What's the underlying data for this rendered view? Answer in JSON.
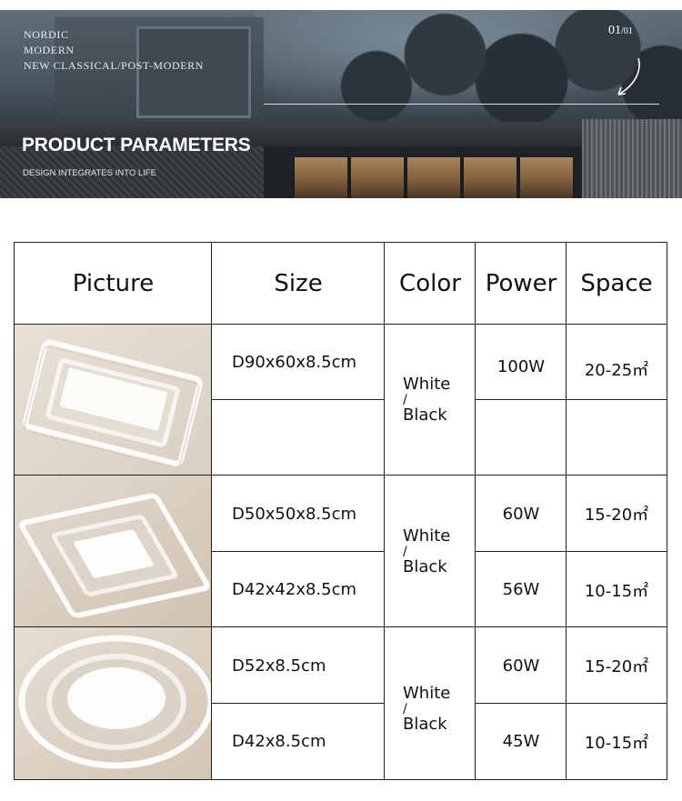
{
  "banner": {
    "tag_lines": [
      "NORDIC",
      "MODERN",
      "NEW CLASSICAL/POST-MODERN"
    ],
    "page_current": "01",
    "page_total": "/01",
    "title": "PRODUCT PARAMETERS",
    "subtitle": "DESIGN INTEGRATES INTO LIFE"
  },
  "table": {
    "headers": [
      "Picture",
      "Size",
      "Color",
      "Power",
      "Space"
    ],
    "groups": [
      {
        "picture": "rectangular-lamp-image",
        "color": [
          "White",
          "/",
          "Black"
        ],
        "rows": [
          {
            "size": "D90x60x8.5cm",
            "power": "100W",
            "space": "20-25㎡"
          },
          {
            "size": "",
            "power": "",
            "space": ""
          }
        ]
      },
      {
        "picture": "square-lamp-image",
        "color": [
          "White",
          "/",
          "Black"
        ],
        "rows": [
          {
            "size": "D50x50x8.5cm",
            "power": "60W",
            "space": "15-20㎡"
          },
          {
            "size": "D42x42x8.5cm",
            "power": "56W",
            "space": "10-15㎡"
          }
        ]
      },
      {
        "picture": "round-lamp-image",
        "color": [
          "White",
          "/",
          "Black"
        ],
        "rows": [
          {
            "size": "D52x8.5cm",
            "power": "60W",
            "space": "15-20㎡"
          },
          {
            "size": "D42x8.5cm",
            "power": "45W",
            "space": "10-15㎡"
          }
        ]
      }
    ]
  }
}
